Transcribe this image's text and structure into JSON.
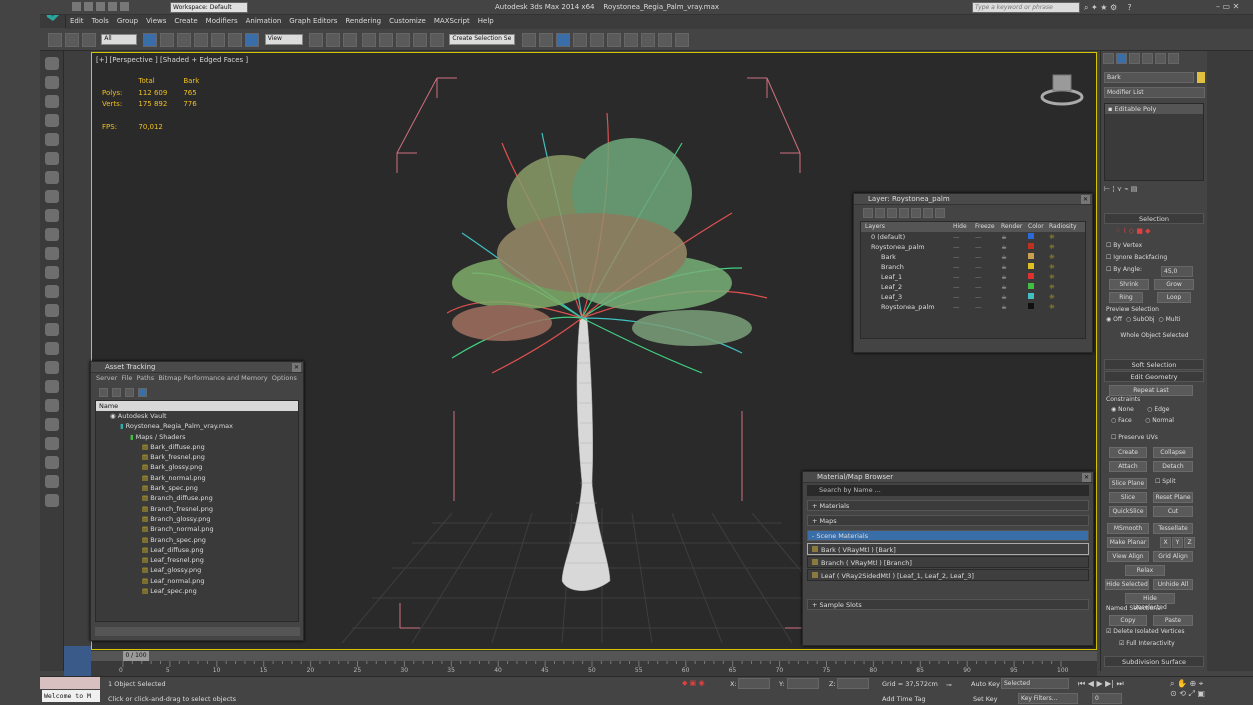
{
  "window": {
    "title": "Autodesk 3ds Max  2014 x64",
    "file": "Roystonea_Regia_Palm_vray.max",
    "workspace": "Workspace: Default",
    "search_placeholder": "Type a keyword or phrase"
  },
  "menu": [
    "Edit",
    "Tools",
    "Group",
    "Views",
    "Create",
    "Modifiers",
    "Animation",
    "Graph Editors",
    "Rendering",
    "Customize",
    "MAXScript",
    "Help"
  ],
  "toolbar": {
    "filter": "All",
    "refcoord": "View",
    "selection_set": "Create Selection Se"
  },
  "viewport": {
    "label": "[+] [Perspective ] [Shaded + Edged Faces ]",
    "stats": {
      "h_total": "Total",
      "h_bark": "Bark",
      "polys_label": "Polys:",
      "polys_total": "112 609",
      "polys_bark": "765",
      "verts_label": "Verts:",
      "verts_total": "175 892",
      "verts_bark": "776",
      "fps_label": "FPS:",
      "fps": "70,012"
    }
  },
  "cmdpanel": {
    "object_name": "Bark",
    "modifier_list": "Modifier List",
    "stack_item": "Editable Poly",
    "selection": "Selection",
    "by_vertex": "By Vertex",
    "ignore_backfacing": "Ignore Backfacing",
    "by_angle": "By Angle:",
    "angle": "45,0",
    "shrink": "Shrink",
    "grow": "Grow",
    "ring": "Ring",
    "loop": "Loop",
    "preview_selection": "Preview Selection",
    "off": "Off",
    "subobj": "SubObj",
    "multi": "Multi",
    "whole_object": "Whole Object Selected",
    "soft_selection": "Soft Selection",
    "edit_geometry": "Edit Geometry",
    "repeat_last": "Repeat Last",
    "constraints": "Constraints",
    "none": "None",
    "edge": "Edge",
    "face": "Face",
    "normal": "Normal",
    "preserve_uvs": "Preserve UVs",
    "create": "Create",
    "collapse": "Collapse",
    "attach": "Attach",
    "detach": "Detach",
    "slice_plane": "Slice Plane",
    "split": "Split",
    "slice": "Slice",
    "reset_plane": "Reset Plane",
    "quickslice": "QuickSlice",
    "cut": "Cut",
    "msmooth": "MSmooth",
    "tessellate": "Tessellate",
    "make_planar": "Make Planar",
    "x": "X",
    "y": "Y",
    "z": "Z",
    "view_align": "View Align",
    "grid_align": "Grid Align",
    "relax": "Relax",
    "hide_selected": "Hide Selected",
    "unhide_all": "Unhide All",
    "hide_unselected": "Hide Unselected",
    "named_selections": "Named Selections:",
    "copy": "Copy",
    "paste": "Paste",
    "delete_isolated": "Delete Isolated Vertices",
    "full_interactivity": "Full Interactivity",
    "subdivision_surface": "Subdivision Surface"
  },
  "layer_dialog": {
    "title": "Layer: Roystonea_palm",
    "columns": [
      "Layers",
      "Hide",
      "Freeze",
      "Render",
      "Color",
      "Radiosity"
    ],
    "rows": [
      {
        "name": "0 (default)",
        "color": "#2a6ad8"
      },
      {
        "name": "Roystonea_palm",
        "color": "#c03020"
      },
      {
        "name": "Bark",
        "color": "#c8a050"
      },
      {
        "name": "Branch",
        "color": "#e0c020"
      },
      {
        "name": "Leaf_1",
        "color": "#e03030"
      },
      {
        "name": "Leaf_2",
        "color": "#40c040"
      },
      {
        "name": "Leaf_3",
        "color": "#40c0c0"
      },
      {
        "name": "Roystonea_palm",
        "color": "#101010"
      }
    ]
  },
  "asset_tracking": {
    "title": "Asset Tracking",
    "menu": [
      "Server",
      "File",
      "Paths",
      "Bitmap Performance and Memory",
      "Options"
    ],
    "col_name": "Name",
    "vault": "Autodesk Vault",
    "file": "Roystonea_Regia_Palm_vray.max",
    "maps": "Maps / Shaders",
    "files": [
      "Bark_diffuse.png",
      "Bark_fresnel.png",
      "Bark_glossy.png",
      "Bark_normal.png",
      "Bark_spec.png",
      "Branch_diffuse.png",
      "Branch_fresnel.png",
      "Branch_glossy.png",
      "Branch_normal.png",
      "Branch_spec.png",
      "Leaf_diffuse.png",
      "Leaf_fresnel.png",
      "Leaf_glossy.png",
      "Leaf_normal.png",
      "Leaf_spec.png"
    ]
  },
  "material_browser": {
    "title": "Material/Map Browser",
    "search": "Search by Name ...",
    "materials": "+ Materials",
    "maps": "+ Maps",
    "scene_materials": "- Scene Materials",
    "items": [
      "Bark  ( VRayMtl )  [Bark]",
      "Branch  ( VRayMtl )  [Branch]",
      "Leaf  ( VRay2SidedMtl )  [Leaf_1, Leaf_2, Leaf_3]"
    ],
    "sample_slots": "+ Sample Slots"
  },
  "timeline": {
    "frame": "0 / 100",
    "ticks": [
      "0",
      "5",
      "10",
      "15",
      "20",
      "25",
      "30",
      "35",
      "40",
      "45",
      "50",
      "55",
      "60",
      "65",
      "70",
      "75",
      "80",
      "85",
      "90",
      "95",
      "100"
    ]
  },
  "status": {
    "listener": "Welcome to M",
    "objects": "1 Object Selected",
    "prompt": "Click or click-and-drag to select objects",
    "x_label": "X:",
    "y_label": "Y:",
    "z_label": "Z:",
    "grid": "Grid = 37,572cm",
    "add_time_tag": "Add Time Tag",
    "auto_key": "Auto Key",
    "selected": "Selected",
    "set_key": "Set Key",
    "key_filters": "Key Filters...",
    "frame_field": "0"
  }
}
